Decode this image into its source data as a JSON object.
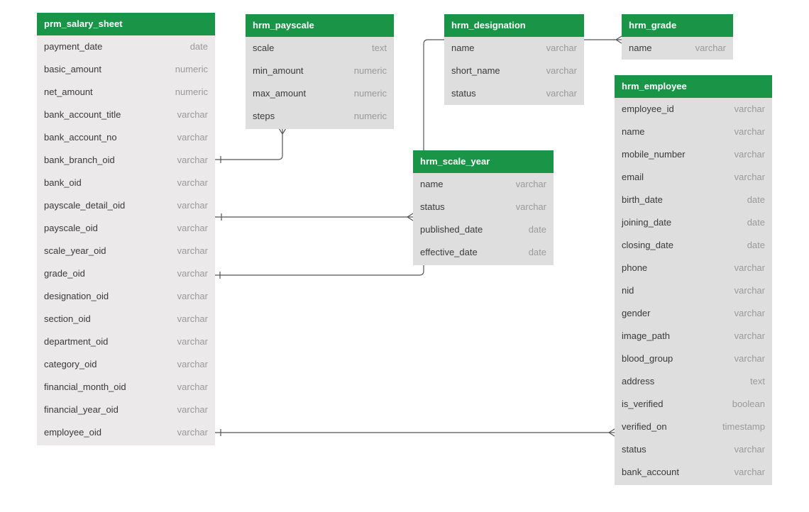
{
  "colors": {
    "header_bg": "#1a9547",
    "header_text": "#ffffff",
    "body_bg_main": "#ebe9ea",
    "body_bg": "#dedede",
    "field_text": "#3a3a3a",
    "type_text": "#9a9a9a",
    "line": "#555555"
  },
  "entities": {
    "prm_salary_sheet": {
      "title": "prm_salary_sheet",
      "fields": [
        {
          "name": "payment_date",
          "type": "date"
        },
        {
          "name": "basic_amount",
          "type": "numeric"
        },
        {
          "name": "net_amount",
          "type": "numeric"
        },
        {
          "name": "bank_account_title",
          "type": "varchar"
        },
        {
          "name": "bank_account_no",
          "type": "varchar"
        },
        {
          "name": "bank_branch_oid",
          "type": "varchar"
        },
        {
          "name": "bank_oid",
          "type": "varchar"
        },
        {
          "name": "payscale_detail_oid",
          "type": "varchar"
        },
        {
          "name": "payscale_oid",
          "type": "varchar"
        },
        {
          "name": "scale_year_oid",
          "type": "varchar"
        },
        {
          "name": "grade_oid",
          "type": "varchar"
        },
        {
          "name": "designation_oid",
          "type": "varchar"
        },
        {
          "name": "section_oid",
          "type": "varchar"
        },
        {
          "name": "department_oid",
          "type": "varchar"
        },
        {
          "name": "category_oid",
          "type": "varchar"
        },
        {
          "name": "financial_month_oid",
          "type": "varchar"
        },
        {
          "name": "financial_year_oid",
          "type": "varchar"
        },
        {
          "name": "employee_oid",
          "type": "varchar"
        }
      ]
    },
    "hrm_payscale": {
      "title": "hrm_payscale",
      "fields": [
        {
          "name": "scale",
          "type": "text"
        },
        {
          "name": "min_amount",
          "type": "numeric"
        },
        {
          "name": "max_amount",
          "type": "numeric"
        },
        {
          "name": "steps",
          "type": "numeric"
        }
      ]
    },
    "hrm_designation": {
      "title": "hrm_designation",
      "fields": [
        {
          "name": "name",
          "type": "varchar"
        },
        {
          "name": "short_name",
          "type": "varchar"
        },
        {
          "name": "status",
          "type": "varchar"
        }
      ]
    },
    "hrm_grade": {
      "title": "hrm_grade",
      "fields": [
        {
          "name": "name",
          "type": "varchar"
        }
      ]
    },
    "hrm_scale_year": {
      "title": "hrm_scale_year",
      "fields": [
        {
          "name": "name",
          "type": "varchar"
        },
        {
          "name": "status",
          "type": "varchar"
        },
        {
          "name": "published_date",
          "type": "date"
        },
        {
          "name": "effective_date",
          "type": "date"
        }
      ]
    },
    "hrm_employee": {
      "title": "hrm_employee",
      "fields": [
        {
          "name": "employee_id",
          "type": "varchar"
        },
        {
          "name": "name",
          "type": "varchar"
        },
        {
          "name": "mobile_number",
          "type": "varchar"
        },
        {
          "name": "email",
          "type": "varchar"
        },
        {
          "name": "birth_date",
          "type": "date"
        },
        {
          "name": "joining_date",
          "type": "date"
        },
        {
          "name": "closing_date",
          "type": "date"
        },
        {
          "name": "phone",
          "type": "varchar"
        },
        {
          "name": "nid",
          "type": "varchar"
        },
        {
          "name": "gender",
          "type": "varchar"
        },
        {
          "name": "image_path",
          "type": "varchar"
        },
        {
          "name": "blood_group",
          "type": "varchar"
        },
        {
          "name": "address",
          "type": "text"
        },
        {
          "name": "is_verified",
          "type": "boolean"
        },
        {
          "name": "verified_on",
          "type": "timestamp"
        },
        {
          "name": "status",
          "type": "varchar"
        },
        {
          "name": "bank_account",
          "type": "varchar"
        }
      ]
    }
  }
}
